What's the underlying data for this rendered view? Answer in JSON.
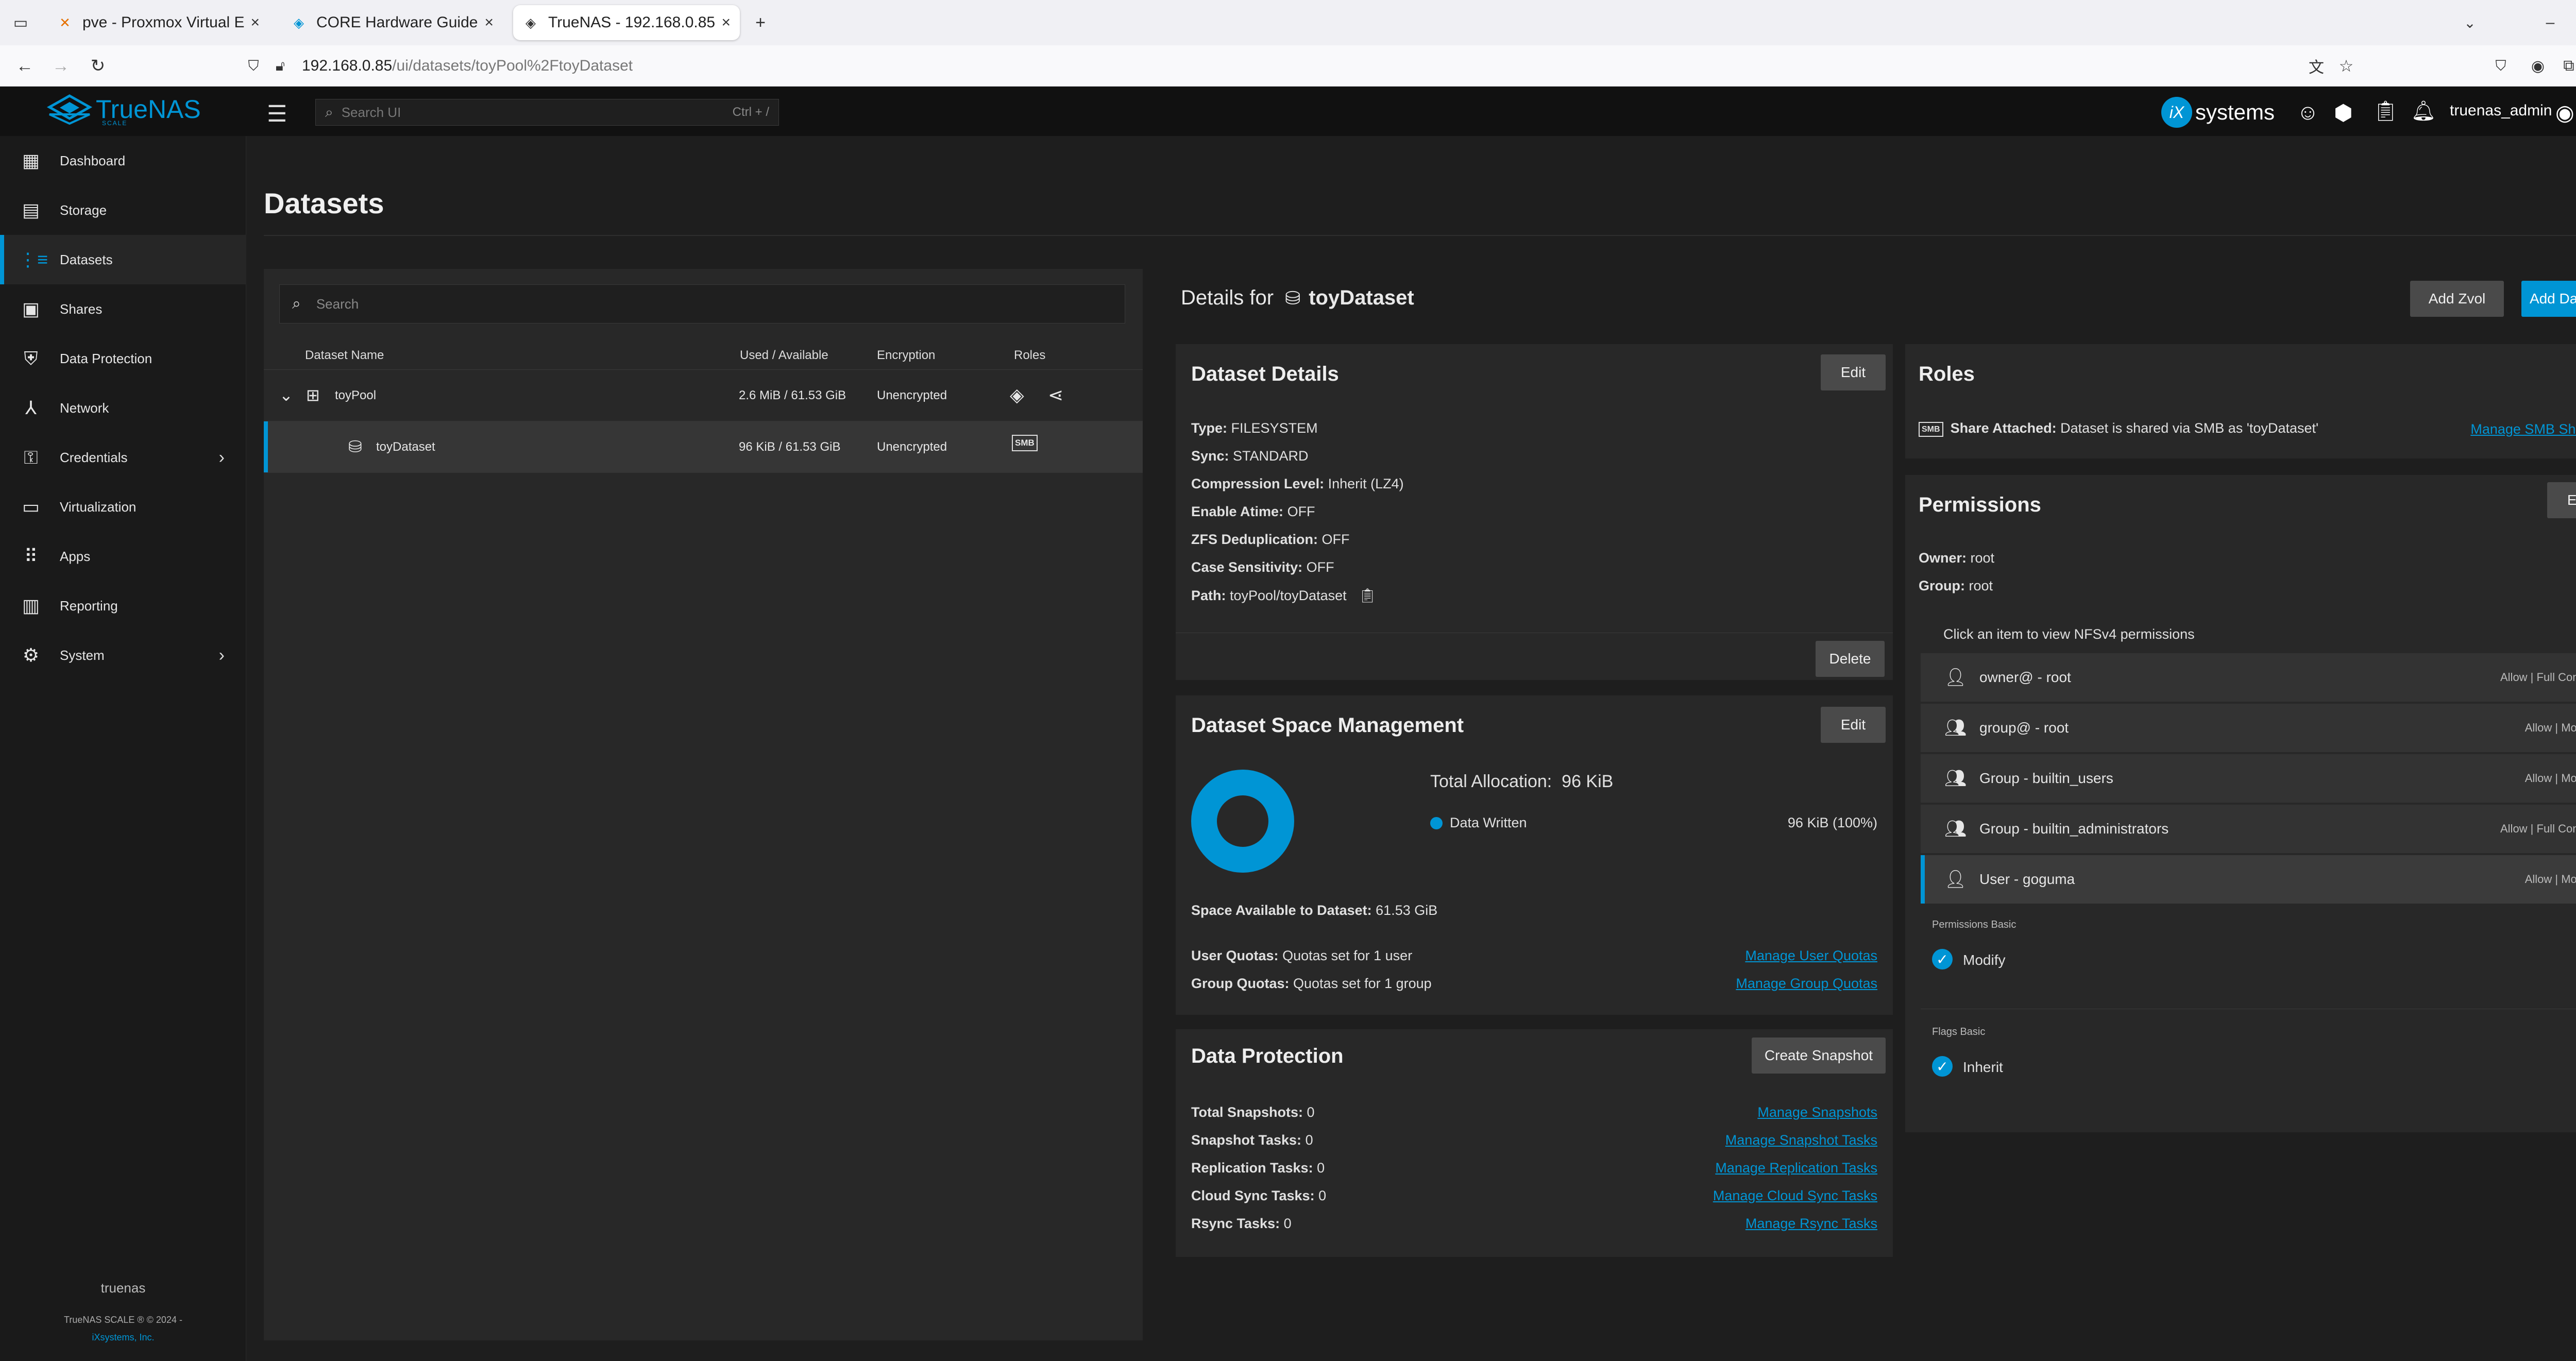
{
  "browser": {
    "tabs": [
      {
        "label": "pve - Proxmox Virtual En",
        "active": false
      },
      {
        "label": "CORE Hardware Guide | T",
        "active": false
      },
      {
        "label": "TrueNAS - 192.168.0.85",
        "active": true
      }
    ],
    "url_host": "192.168.0.85",
    "url_path": "/ui/datasets/toyPool%2FtoyDataset"
  },
  "header": {
    "logo_text": "TrueNAS",
    "logo_sub": "SCALE",
    "search_placeholder": "Search UI",
    "search_shortcut": "Ctrl + /",
    "vendor": "systems",
    "vendor_mark": "iX",
    "username": "truenas_admin"
  },
  "sidebar": {
    "items": [
      {
        "label": "Dashboard",
        "icon": "dashboard-icon"
      },
      {
        "label": "Storage",
        "icon": "storage-icon"
      },
      {
        "label": "Datasets",
        "icon": "datasets-icon"
      },
      {
        "label": "Shares",
        "icon": "shares-icon"
      },
      {
        "label": "Data Protection",
        "icon": "shield-icon"
      },
      {
        "label": "Network",
        "icon": "network-icon"
      },
      {
        "label": "Credentials",
        "icon": "key-icon"
      },
      {
        "label": "Virtualization",
        "icon": "laptop-icon"
      },
      {
        "label": "Apps",
        "icon": "apps-grid-icon"
      },
      {
        "label": "Reporting",
        "icon": "chart-icon"
      },
      {
        "label": "System",
        "icon": "gear-icon"
      }
    ],
    "active_index": 2,
    "hostname": "truenas",
    "copyright": "TrueNAS SCALE ® © 2024 -",
    "company": "iXsystems, Inc."
  },
  "page": {
    "title": "Datasets"
  },
  "tree": {
    "search_placeholder": "Search",
    "columns": [
      "Dataset Name",
      "Used / Available",
      "Encryption",
      "Roles"
    ],
    "rows": [
      {
        "name": "toyPool",
        "used": "2.6 MiB / 61.53 GiB",
        "encryption": "Unencrypted"
      },
      {
        "name": "toyDataset",
        "used": "96 KiB / 61.53 GiB",
        "encryption": "Unencrypted",
        "roles_badge": "SMB"
      }
    ]
  },
  "details": {
    "title_prefix": "Details for",
    "dataset_name": "toyDataset",
    "add_zvol": "Add Zvol",
    "add_dataset": "Add Dataset"
  },
  "dataset_details": {
    "title": "Dataset Details",
    "edit": "Edit",
    "delete": "Delete",
    "fields": [
      {
        "key": "Type:",
        "value": "FILESYSTEM"
      },
      {
        "key": "Sync:",
        "value": "STANDARD"
      },
      {
        "key": "Compression Level:",
        "value": "Inherit (LZ4)"
      },
      {
        "key": "Enable Atime:",
        "value": "OFF"
      },
      {
        "key": "ZFS Deduplication:",
        "value": "OFF"
      },
      {
        "key": "Case Sensitivity:",
        "value": "OFF"
      },
      {
        "key": "Path:",
        "value": "toyPool/toyDataset"
      }
    ]
  },
  "space": {
    "title": "Dataset Space Management",
    "edit": "Edit",
    "total_label": "Total Allocation:",
    "total_value": "96 KiB",
    "legend_label": "Data Written",
    "legend_value": "96 KiB (100%)",
    "written_fraction": 1.0,
    "color": "#0095d5",
    "available_key": "Space Available to Dataset:",
    "available_value": "61.53 GiB",
    "user_quotas_key": "User Quotas:",
    "user_quotas_value": "Quotas set for 1 user",
    "user_quotas_link": "Manage User Quotas",
    "group_quotas_key": "Group Quotas:",
    "group_quotas_value": "Quotas set for 1 group",
    "group_quotas_link": "Manage Group Quotas"
  },
  "protection": {
    "title": "Data Protection",
    "create_snapshot": "Create Snapshot",
    "rows": [
      {
        "key": "Total Snapshots:",
        "value": "0",
        "link": "Manage Snapshots"
      },
      {
        "key": "Snapshot Tasks:",
        "value": "0",
        "link": "Manage Snapshot Tasks"
      },
      {
        "key": "Replication Tasks:",
        "value": "0",
        "link": "Manage Replication Tasks"
      },
      {
        "key": "Cloud Sync Tasks:",
        "value": "0",
        "link": "Manage Cloud Sync Tasks"
      },
      {
        "key": "Rsync Tasks:",
        "value": "0",
        "link": "Manage Rsync Tasks"
      }
    ]
  },
  "roles": {
    "title": "Roles",
    "badge": "SMB",
    "share_key": "Share Attached:",
    "share_text": "Dataset is shared via SMB as 'toyDataset'",
    "manage_link": "Manage SMB Shares"
  },
  "permissions": {
    "title": "Permissions",
    "edit": "Edit",
    "owner_key": "Owner:",
    "owner_value": "root",
    "group_key": "Group:",
    "group_value": "root",
    "hint": "Click an item to view NFSv4 permissions",
    "entries": [
      {
        "label": "owner@ - root",
        "value": "Allow | Full Control",
        "icon": "person-icon"
      },
      {
        "label": "group@ - root",
        "value": "Allow | Modify",
        "icon": "group-icon"
      },
      {
        "label": "Group - builtin_users",
        "value": "Allow | Modify",
        "icon": "group-icon"
      },
      {
        "label": "Group - builtin_administrators",
        "value": "Allow | Full Control",
        "icon": "group-icon"
      },
      {
        "label": "User - goguma",
        "value": "Allow | Modify",
        "icon": "person-icon"
      }
    ],
    "selected_index": 4,
    "basic_label": "Permissions Basic",
    "basic_value": "Modify",
    "flags_label": "Flags Basic",
    "flags_value": "Inherit"
  }
}
